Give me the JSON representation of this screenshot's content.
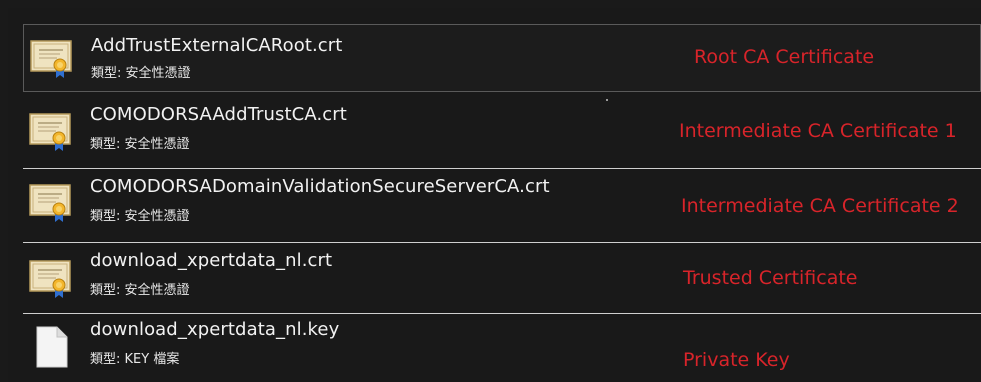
{
  "files": [
    {
      "name": "AddTrustExternalCARoot.crt",
      "type": "類型: 安全性憑證",
      "icon": "certificate-icon",
      "annotation": "Root CA Certificate"
    },
    {
      "name": "COMODORSAAddTrustCA.crt",
      "type": "類型: 安全性憑證",
      "icon": "certificate-icon",
      "annotation": "Intermediate CA Certificate 1"
    },
    {
      "name": "COMODORSADomainValidationSecureServerCA.crt",
      "type": "類型: 安全性憑證",
      "icon": "certificate-icon",
      "annotation": "Intermediate CA Certificate 2"
    },
    {
      "name": "download_xpertdata_nl.crt",
      "type": "類型: 安全性憑證",
      "icon": "certificate-icon",
      "annotation": "Trusted Certificate"
    },
    {
      "name": "download_xpertdata_nl.key",
      "type": "類型: KEY 檔案",
      "icon": "blank-file-icon",
      "annotation": "Private Key"
    }
  ],
  "colors": {
    "background": "#191919",
    "annotation": "#d8242a",
    "text": "#f2f2f2",
    "separator": "#cfcfcf"
  }
}
